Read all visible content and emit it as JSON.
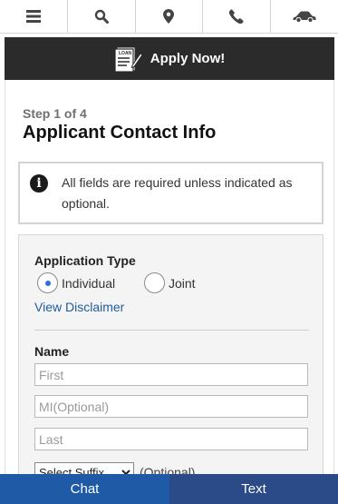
{
  "nav": {
    "icons": [
      "menu-icon",
      "search-icon",
      "location-pin-icon",
      "phone-icon",
      "car-icon"
    ]
  },
  "apply_bar": {
    "label": "Apply Now!",
    "icon_text": "LOAN"
  },
  "step": {
    "label": "Step 1 of 4",
    "title": "Applicant Contact Info"
  },
  "info": {
    "message": "All fields are required unless indicated as optional."
  },
  "form": {
    "application_type": {
      "label": "Application Type",
      "options": [
        {
          "label": "Individual",
          "selected": true
        },
        {
          "label": "Joint",
          "selected": false
        }
      ]
    },
    "disclaimer_link": "View Disclaimer",
    "name": {
      "label": "Name",
      "first_placeholder": "First",
      "mi_placeholder": "MI(Optional)",
      "last_placeholder": "Last",
      "suffix_selected": "Select Suffix",
      "suffix_optional": "(Optional)"
    }
  },
  "bottom": {
    "chat_label": "Chat",
    "text_label": "Text"
  },
  "colors": {
    "apply_bar_bg": "#2b2b2b",
    "link": "#1f5c9e",
    "chat_bg": "#1f5aa6",
    "text_bg": "#2a4a88",
    "radio_dot": "#2f6fd6"
  }
}
